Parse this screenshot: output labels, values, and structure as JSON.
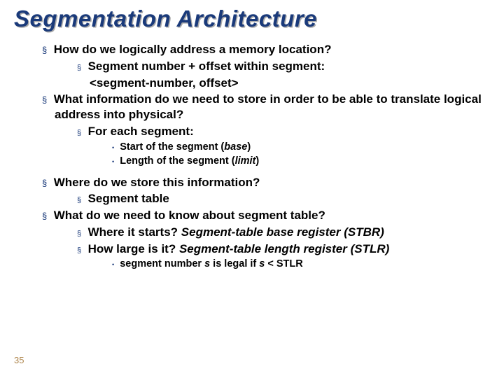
{
  "title": "Segmentation Architecture",
  "b1": "How do we logically address a memory location?",
  "b1a": "Segment number   + offset within segment:",
  "b1a2": "<segment-number, offset>",
  "b2": "What information do we need to store in order to be able to translate logical address into physical?",
  "b2a": "For each segment:",
  "b2a1_pre": "Start of the segment (",
  "b2a1_it": "base",
  "b2a1_post": ")",
  "b2a2_pre": "Length of the segment (",
  "b2a2_it": "limit",
  "b2a2_post": ")",
  "b3": "Where do we store this information?",
  "b3a": "Segment table",
  "b4": "What do we need to know about segment table?",
  "b4a_pre": "Where it starts? ",
  "b4a_it": "Segment-table base register (STBR)",
  "b4b_pre": "How large is it? ",
  "b4b_it": "Segment-table length register (STLR)",
  "b4b1_1": "segment number ",
  "b4b1_s": "s",
  "b4b1_2": " is legal if ",
  "b4b1_3": " < STLR",
  "pagenum": "35",
  "sq": "§",
  "dot": "•"
}
